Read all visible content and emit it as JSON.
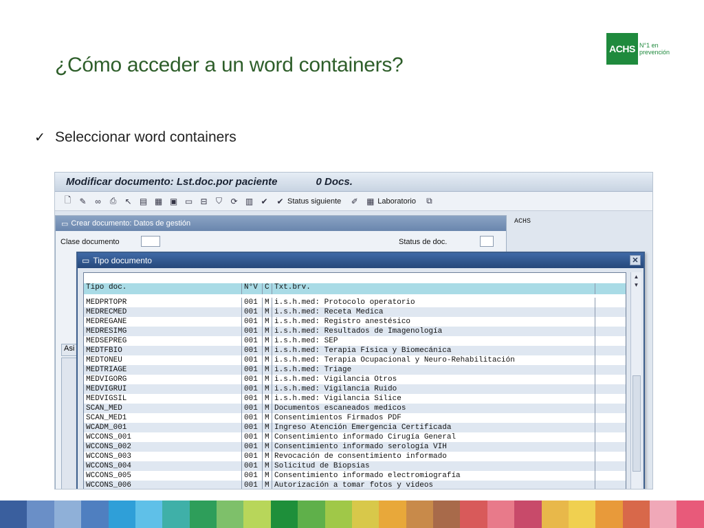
{
  "slide": {
    "title": "¿Cómo acceder a un word containers?",
    "bullet": "Seleccionar word containers",
    "logo_text": "ACHS",
    "logo_tagline": "N°1 en prevención"
  },
  "sap": {
    "window_title": "Modificar documento: Lst.doc.por paciente",
    "docs_count": "0 Docs.",
    "toolbar": {
      "status_label": "Status siguiente",
      "lab_label": "Laboratorio"
    },
    "back_panel": {
      "title": "Crear documento: Datos de gestión",
      "clase_label": "Clase documento",
      "status_label": "Status de doc.",
      "achs_label": "ACHS",
      "tab_label": "Asi"
    },
    "dialog": {
      "title": "Tipo documento",
      "headers": [
        "Tipo doc.",
        "N°V",
        "C",
        "Txt.brv."
      ],
      "rows": [
        [
          "MEDPRTOPR",
          "001",
          "M",
          "i.s.h.med: Protocolo operatorio"
        ],
        [
          "MEDRECMED",
          "001",
          "M",
          "i.s.h.med: Receta Medica"
        ],
        [
          "MEDREGANE",
          "001",
          "M",
          "i.s.h.med: Registro anestésico"
        ],
        [
          "MEDRESIMG",
          "001",
          "M",
          "i.s.h.med: Resultados de Imagenología"
        ],
        [
          "MEDSEPREG",
          "001",
          "M",
          "i.s.h.med: SEP"
        ],
        [
          "MEDTFBIO",
          "001",
          "M",
          "i.s.h.med: Terapia Física y Biomecánica"
        ],
        [
          "MEDTONEU",
          "001",
          "M",
          "i.s.h.med: Terapia Ocupacional y Neuro-Rehabilitación"
        ],
        [
          "MEDTRIAGE",
          "001",
          "M",
          "i.s.h.med: Triage"
        ],
        [
          "MEDVIGORG",
          "001",
          "M",
          "i.s.h.med: Vigilancia Otros"
        ],
        [
          "MEDVIGRUI",
          "001",
          "M",
          "i.s.h.med: Vigilancia Ruido"
        ],
        [
          "MEDVIGSIL",
          "001",
          "M",
          "i.s.h.med: Vigilancia Sílice"
        ],
        [
          "SCAN_MED",
          "001",
          "M",
          "Documentos escaneados medicos"
        ],
        [
          "SCAN_MED1",
          "001",
          "M",
          "Consentimientos Firmados PDF"
        ],
        [
          "WCADM_001",
          "001",
          "M",
          "Ingreso Atención Emergencia Certificada"
        ],
        [
          "WCCONS_001",
          "001",
          "M",
          "Consentimiento informado Cirugía General"
        ],
        [
          "WCCONS_002",
          "001",
          "M",
          "Consentimiento informado serología VIH"
        ],
        [
          "WCCONS_003",
          "001",
          "M",
          "Revocación de consentimiento informado"
        ],
        [
          "WCCONS_004",
          "001",
          "M",
          "Solicitud de Biopsias"
        ],
        [
          "WCCONS_005",
          "001",
          "M",
          "Consentimiento informado electromiografía"
        ],
        [
          "WCCONS_006",
          "001",
          "M",
          "Autorización a tomar fotos y videos"
        ]
      ]
    }
  },
  "colors": {
    "title_green": "#2e5e2a",
    "logo_green": "#1f8a3d",
    "dialog_header": "#26487a",
    "table_header": "#a9dbe6",
    "stripe": [
      "#3a5f9e",
      "#6a8fc7",
      "#8fb0d8",
      "#4f7fc0",
      "#2f9fd8",
      "#5fc0e8",
      "#3fb0a8",
      "#2e9e5a",
      "#7ec06a",
      "#b8d65a",
      "#1e8f3a",
      "#5fb04a",
      "#a0c848",
      "#d8c84a",
      "#e8a83a",
      "#c88a4a",
      "#a86a4a",
      "#d85a5a",
      "#e87a8a",
      "#c84a6a",
      "#e8b84a",
      "#f0d050",
      "#e89a3a",
      "#d8684a",
      "#f0a8b8",
      "#e85a7a"
    ]
  }
}
